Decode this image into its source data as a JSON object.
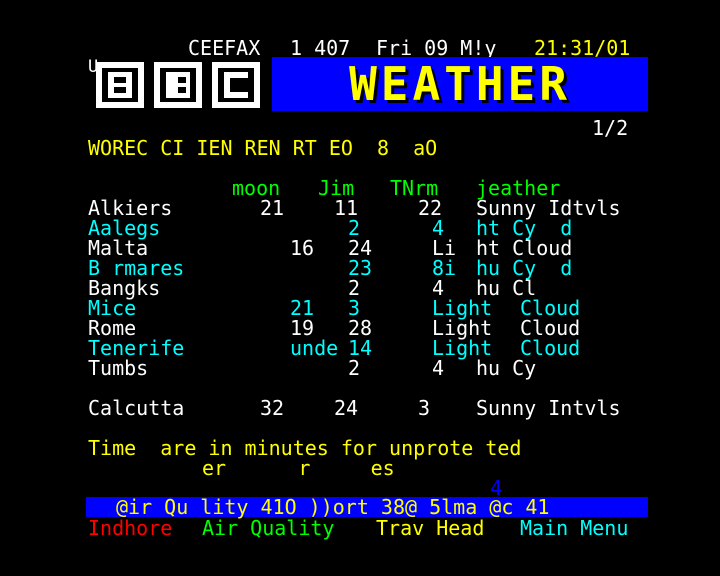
{
  "header": {
    "service": "CEEFAX",
    "page_num": "1 407",
    "date": "Fri 09 M!y",
    "time": "21:31/01"
  },
  "logo": {
    "mark": "BBC",
    "prefix": "U"
  },
  "banner": {
    "title": "WEATHER"
  },
  "subpage": "1/2",
  "heading": "WOREC CI IEN REN RT EO  8  aO",
  "columns": {
    "c1": "moon",
    "c2": "Jim",
    "c3": "TNrm",
    "c4": "jeather"
  },
  "rows": [
    {
      "city": "Alkiers",
      "a": "21",
      "b": "11",
      "c": "22",
      "d": "Sunny Idtvls",
      "color": "#ffffff"
    },
    {
      "city": "Aalegs",
      "a": "",
      "b": "2",
      "c": "4",
      "d": "ht Cy  d",
      "color": "#00ffff"
    },
    {
      "city": "Malta",
      "a": "16",
      "b": "24",
      "c": "Li",
      "d": "ht Cloud",
      "color": "#ffffff"
    },
    {
      "city": "B rmares",
      "a": "",
      "b": "23",
      "c": "8i",
      "d": "hu Cy  d",
      "color": "#00ffff"
    },
    {
      "city": "Bangks",
      "a": "",
      "b": "2",
      "c": "4",
      "d": "hu Cl",
      "color": "#ffffff"
    },
    {
      "city": "Mice",
      "a": "21",
      "b": "3",
      "c": "Light",
      "d": "Cloud",
      "color": "#00ffff"
    },
    {
      "city": "Rome",
      "a": "19",
      "b": "28",
      "c": "Light",
      "d": "Cloud",
      "color": "#ffffff"
    },
    {
      "city": "Tenerife",
      "a": "unde",
      "b": "14",
      "c": "Light",
      "d": "Cloud",
      "color": "#00ffff"
    },
    {
      "city": "Tumbs",
      "a": "",
      "b": "2",
      "c": "4",
      "d": "hu Cy",
      "color": "#ffffff"
    }
  ],
  "calcutta": {
    "city": "Calcutta",
    "a": "32",
    "b": "24",
    "c": "3",
    "d": "Sunny Intvls"
  },
  "footnote": {
    "line1": "Time  are in minutes for unprote ted",
    "line2": "er      r     es"
  },
  "stray": "4",
  "airbar": {
    "text": "@ir Qu lity 41O ))ort 38@ 5lma @c 41"
  },
  "fastext": {
    "red": "Indhore",
    "green": "Air Quality",
    "yellow": "Trav Head",
    "cyan": "Main Menu"
  },
  "colors": {
    "bg": "#000000",
    "banner": "#0000ff",
    "title": "#ffff00"
  }
}
